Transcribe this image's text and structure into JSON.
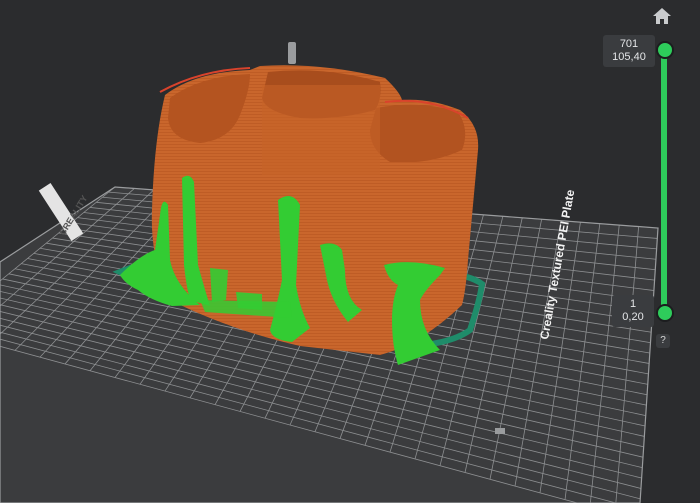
{
  "layer_slider": {
    "top_layer": "701",
    "top_height": "105,40",
    "bottom_layer": "1",
    "bottom_height": "0,20"
  },
  "bed": {
    "brand_label": "CREALITY",
    "plate_label": "Creality Textured PEI Plate"
  },
  "controls": {
    "help_label": "?",
    "home_icon": "home-icon"
  },
  "colors": {
    "background": "#2b2c2e",
    "bed": "#3a3b3d",
    "grid": "#8a8c8e",
    "model": "#c8632a",
    "support": "#33cc33",
    "skirt": "#1f8c6a",
    "slider": "#2ecc5b"
  }
}
